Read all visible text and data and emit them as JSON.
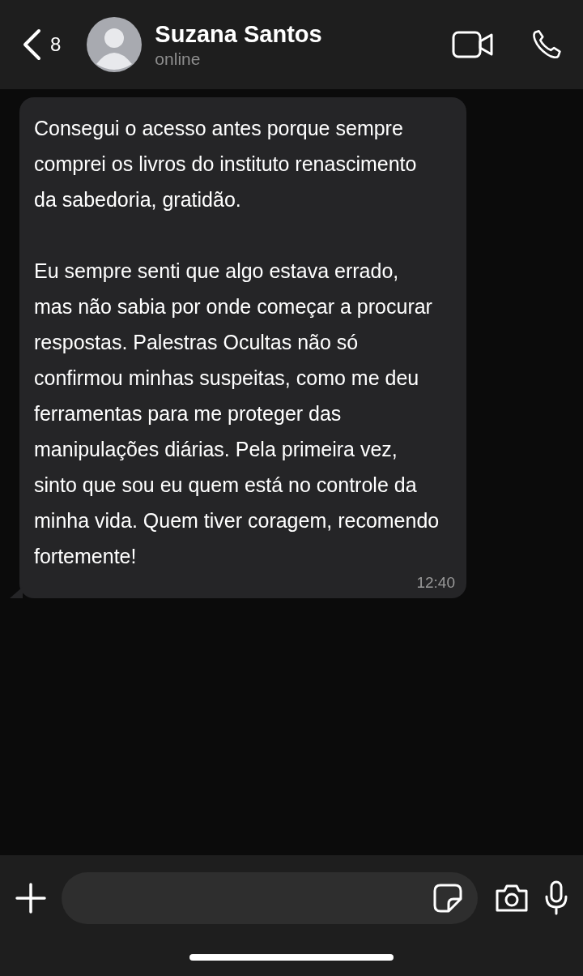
{
  "header": {
    "back_count": "8",
    "name": "Suzana Santos",
    "status": "online"
  },
  "messages": [
    {
      "paragraphs": [
        "Consegui o acesso antes porque sempre comprei os livros do instituto renascimento da sabedoria, gratidão.",
        "Eu sempre senti que algo estava errado, mas não sabia por onde começar a procurar respostas. Palestras Ocultas não só confirmou minhas suspeitas, como me deu ferramentas para me proteger das manipulações diárias. Pela primeira vez, sinto que sou eu quem está no controle da minha vida. Quem tiver coragem, recomendo fortemente!"
      ],
      "time": "12:40"
    }
  ]
}
